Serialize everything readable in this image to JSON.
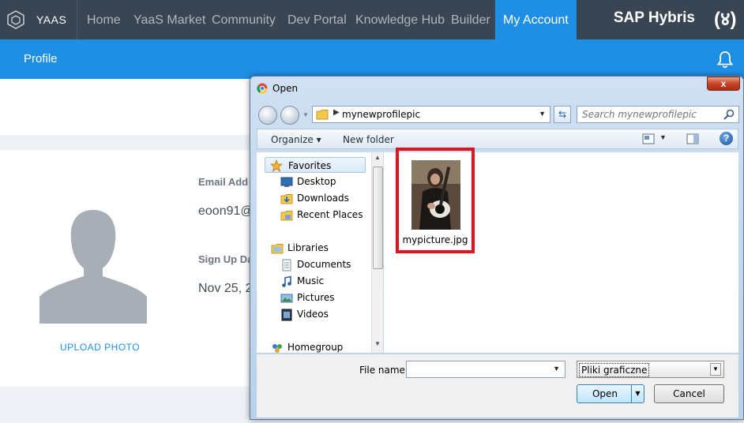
{
  "brand": {
    "name": "YAAS"
  },
  "topnav": {
    "items": [
      {
        "label": "Home"
      },
      {
        "label": "YaaS Market"
      },
      {
        "label": "Community"
      },
      {
        "label": "Dev Portal"
      },
      {
        "label": "Knowledge Hub"
      },
      {
        "label": "Builder"
      },
      {
        "label": "My Account"
      }
    ],
    "active": "My Account",
    "right_brand": "SAP Hybris",
    "right_logo": "(४)"
  },
  "subbar": {
    "title": "Profile"
  },
  "profile": {
    "upload_label": "UPLOAD PHOTO",
    "email_label": "Email Add",
    "email_value": "eoon91@",
    "signup_label": "Sign Up Da",
    "signup_value": "Nov 25, 2"
  },
  "dialog": {
    "title": "Open",
    "close_label": "x",
    "path": "mynewprofilepic",
    "search_placeholder": "Search mynewprofilepic",
    "toolbar": {
      "organize": "Organize ▾",
      "new_folder": "New folder",
      "help": "?"
    },
    "tree": [
      {
        "label": "Favorites",
        "icon": "star-icon",
        "indent": 0,
        "selected": true
      },
      {
        "label": "Desktop",
        "icon": "desktop-icon",
        "indent": 1
      },
      {
        "label": "Downloads",
        "icon": "downloads-icon",
        "indent": 1
      },
      {
        "label": "Recent Places",
        "icon": "recent-places-icon",
        "indent": 1
      },
      {
        "label": "Libraries",
        "icon": "libraries-icon",
        "indent": 0
      },
      {
        "label": "Documents",
        "icon": "documents-icon",
        "indent": 1
      },
      {
        "label": "Music",
        "icon": "music-icon",
        "indent": 1
      },
      {
        "label": "Pictures",
        "icon": "pictures-icon",
        "indent": 1
      },
      {
        "label": "Videos",
        "icon": "videos-icon",
        "indent": 1
      },
      {
        "label": "Homegroup",
        "icon": "homegroup-icon",
        "indent": 0
      }
    ],
    "files": [
      {
        "name": "mypicture.jpg",
        "highlighted": true
      }
    ],
    "filename_label": "File name:",
    "filename_value": "",
    "filetype_value": "Pliki graficzne",
    "open_button": "Open",
    "cancel_button": "Cancel"
  },
  "colors": {
    "nav_bg": "#3a4553",
    "accent": "#1f8fe6",
    "highlight_border": "#e0141f"
  }
}
